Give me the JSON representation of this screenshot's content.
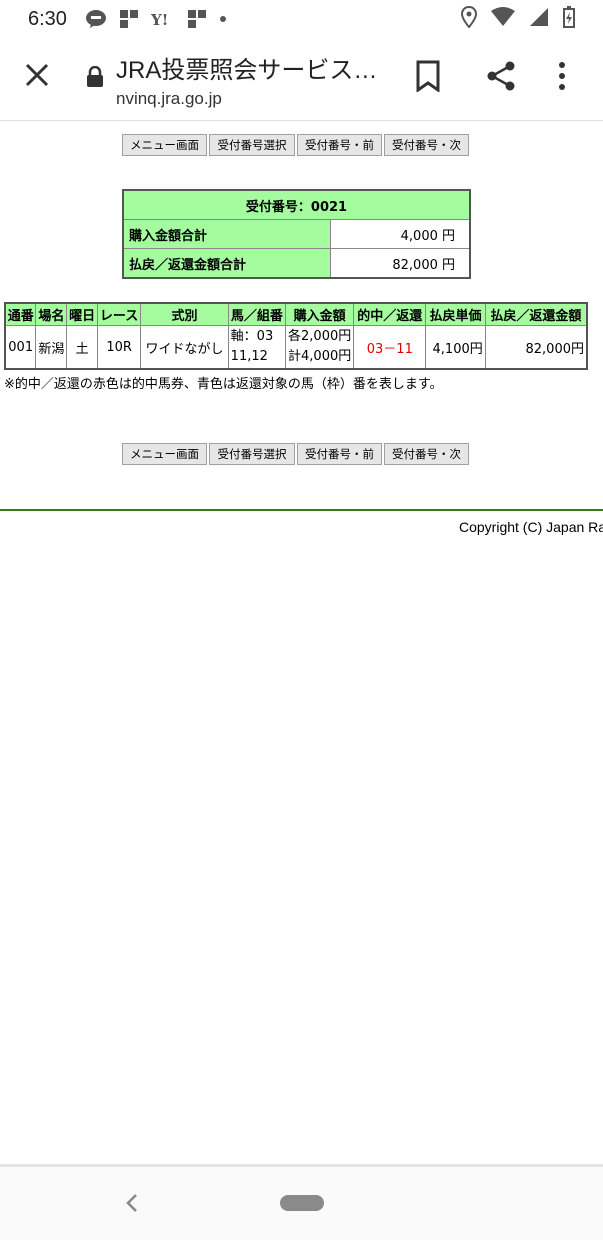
{
  "status_bar": {
    "time": "6:30",
    "left_icons": [
      "line-icon",
      "grid-app-icon",
      "yahoo-icon",
      "grid-app-icon",
      "dot-icon"
    ],
    "right_icons": [
      "location-icon",
      "wifi-icon",
      "signal-icon",
      "battery-icon"
    ]
  },
  "app_bar": {
    "title": "JRA投票照会サービス…",
    "url": "nvinq.jra.go.jp"
  },
  "nav": {
    "menu": "メニュー画面",
    "select": "受付番号選択",
    "prev": "受付番号・前",
    "next": "受付番号・次"
  },
  "summary": {
    "receipt": "受付番号：0021",
    "purchase_label": "購入金額合計",
    "purchase_value": "4,000 円",
    "payout_label": "払戻／返還金額合計",
    "payout_value": "82,000 円"
  },
  "detail": {
    "headers": [
      "通番",
      "場名",
      "曜日",
      "レース",
      "式別",
      "馬／組番",
      "購入金額",
      "的中／返還",
      "払戻単価",
      "払戻／返還金額"
    ],
    "row": {
      "serial": "001",
      "venue": "新潟",
      "day": "土",
      "race": "10R",
      "bet_type": "ワイドながし",
      "horses_line1": "軸：03",
      "horses_line2": "11,12",
      "amount_line1": "各2,000円",
      "amount_line2": "計4,000円",
      "hit": "03－11",
      "unit_payout": "4,100円",
      "total_payout": "82,000円"
    }
  },
  "note": "※的中／返還の赤色は的中馬券、青色は返還対象の馬（枠）番を表します。",
  "footer": {
    "copyright": "Copyright (C) Japan Ra"
  },
  "colors": {
    "header_green": "#a4fc9e",
    "hit_red": "#e00000",
    "divider_green": "#3a7a12"
  }
}
